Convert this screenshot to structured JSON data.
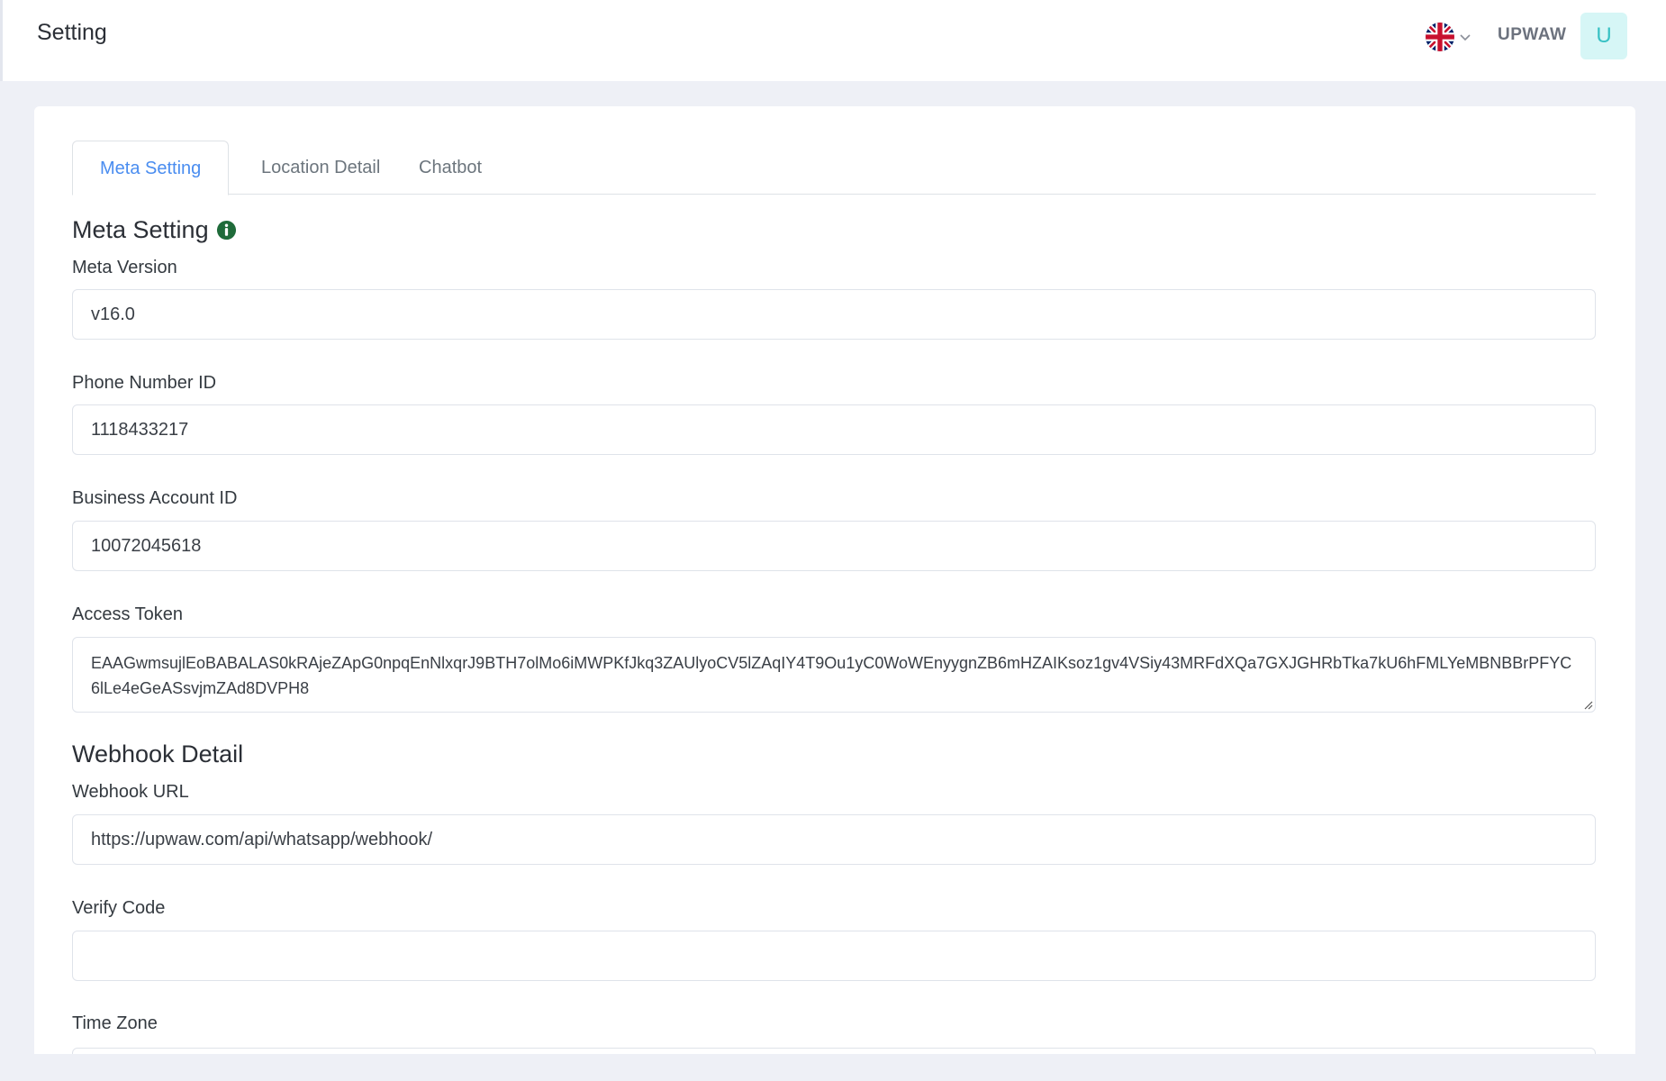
{
  "header": {
    "title": "Setting",
    "username": "UPWAW",
    "avatar_letter": "U",
    "language_icon": "uk-flag-icon"
  },
  "tabs": [
    {
      "label": "Meta Setting",
      "active": true
    },
    {
      "label": "Location Detail",
      "active": false
    },
    {
      "label": "Chatbot",
      "active": false
    }
  ],
  "meta_setting": {
    "title": "Meta Setting",
    "info_icon": "info-circle-icon",
    "meta_version": {
      "label": "Meta Version",
      "value": "v16.0"
    },
    "phone_number_id": {
      "label": "Phone Number ID",
      "value": "1118433217"
    },
    "business_account_id": {
      "label": "Business Account ID",
      "value": "10072045618"
    },
    "access_token": {
      "label": "Access Token",
      "value": "EAAGwmsujlEoBABALAS0kRAjeZApG0npqEnNlxqrJ9BTH7olMo6iMWPKfJkq3ZAUlyoCV5lZAqIY4T9Ou1yC0WoWEnyygnZB6mHZAIKsoz1gv4VSiy43MRFdXQa7GXJGHRbTka7kU6hFMLYeMBNBBrPFYC6lLe4eGeASsvjmZAd8DVPH8"
    }
  },
  "webhook_detail": {
    "title": "Webhook Detail",
    "webhook_url": {
      "label": "Webhook URL",
      "value": "https://upwaw.com/api/whatsapp/webhook/"
    },
    "verify_code": {
      "label": "Verify Code",
      "value": ""
    },
    "time_zone": {
      "label": "Time Zone",
      "value": ""
    }
  },
  "colors": {
    "accent": "#4a8df0",
    "avatar_bg": "#d6f6f6",
    "avatar_text": "#37c1c4",
    "info_icon": "#1f6b3a",
    "page_bg": "#eef0f6"
  }
}
